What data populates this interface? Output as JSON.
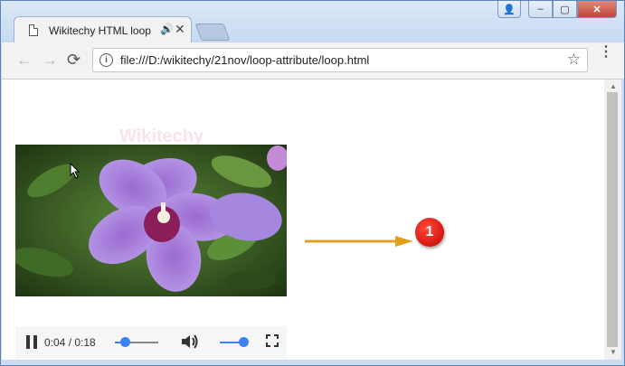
{
  "tab": {
    "title": "Wikitechy HTML loop",
    "close_glyph": "✕",
    "audio_glyph": "🔊"
  },
  "window_buttons": {
    "user": "👤",
    "minimize": "–",
    "maximize": "▢",
    "close": "✕"
  },
  "toolbar": {
    "back_glyph": "←",
    "forward_glyph": "→",
    "reload_glyph": "⟳",
    "url": "file:///D:/wikitechy/21nov/loop-attribute/loop.html",
    "info_glyph": "i",
    "star_glyph": "☆",
    "menu_glyph": "⋮"
  },
  "page": {
    "watermark": "Wikitechy"
  },
  "video": {
    "time": "0:04 / 0:18",
    "progress": 0.22,
    "volume": 1.0
  },
  "annotation": {
    "badge_number": "1"
  },
  "colors": {
    "accent": "#3b82f6",
    "badge": "#e00000",
    "arrow": "#e0a020"
  }
}
